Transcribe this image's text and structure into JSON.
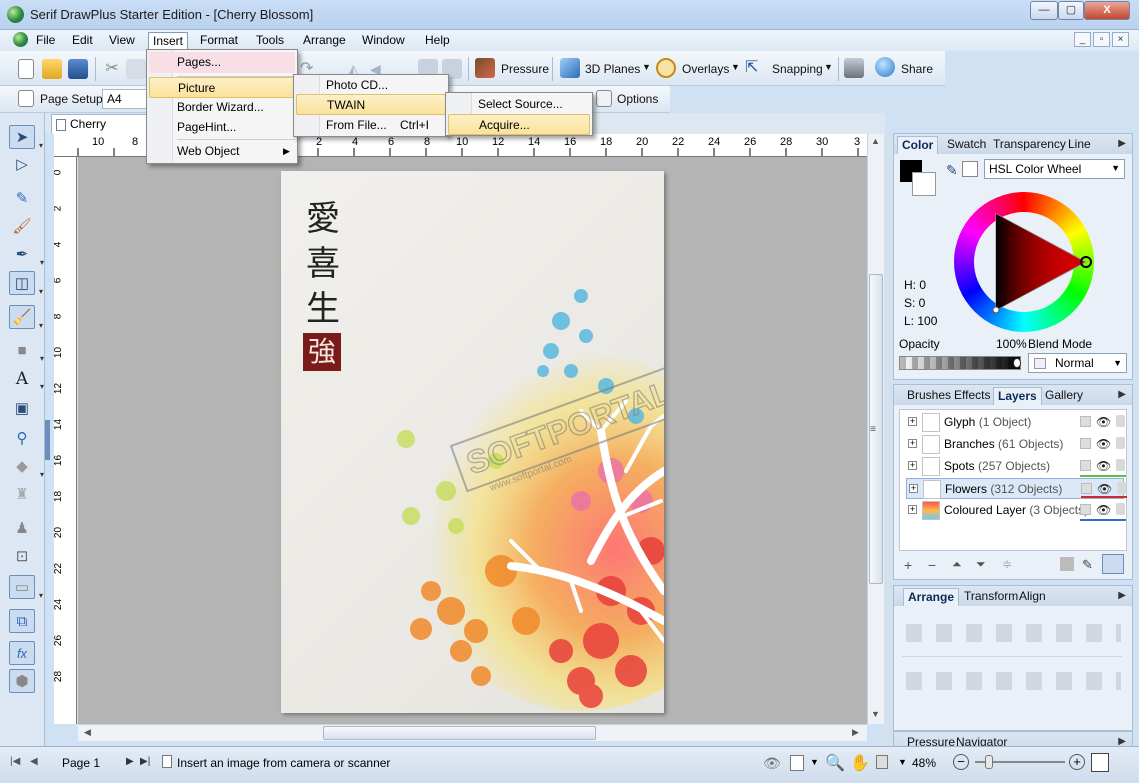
{
  "window": {
    "title": "Serif DrawPlus Starter Edition - [Cherry Blossom]",
    "min": "—",
    "max": "▢",
    "close": "X"
  },
  "menubar": {
    "items": [
      "File",
      "Edit",
      "View",
      "Insert",
      "Format",
      "Tools",
      "Arrange",
      "Window",
      "Help"
    ]
  },
  "toolbar1": {
    "pressure": "Pressure",
    "planes": "3D Planes",
    "overlays": "Overlays",
    "snapping": "Snapping",
    "share": "Share"
  },
  "toolbar2": {
    "page_setup": "Page Setup",
    "page_size": "A4",
    "options": "Options"
  },
  "document_tab": "Cherry Blossom",
  "ruler": {
    "unit": "cm",
    "h_ticks": [
      "10",
      "8",
      "2",
      "4",
      "6",
      "8",
      "10",
      "12",
      "14",
      "16",
      "18",
      "20",
      "22",
      "24",
      "26",
      "28",
      "30",
      "3"
    ],
    "v_ticks": [
      "0",
      "2",
      "4",
      "6",
      "8",
      "10",
      "12",
      "14",
      "16",
      "18",
      "20",
      "22",
      "24",
      "26",
      "28"
    ]
  },
  "artwork": {
    "kanji": [
      "愛",
      "喜",
      "生"
    ],
    "stamp": "強",
    "watermark": "SOFTPORTAL",
    "watermark_url": "www.softportal.com"
  },
  "insert_menu": {
    "items": [
      "Pages...",
      "Picture",
      "Border Wizard...",
      "PageHint...",
      "Web Object"
    ]
  },
  "picture_menu": {
    "items": [
      "Photo CD...",
      "TWAIN",
      "From File..."
    ],
    "from_file_shortcut": "Ctrl+I"
  },
  "twain_menu": {
    "items": [
      "Select Source...",
      "Acquire..."
    ]
  },
  "color_panel": {
    "tabs": [
      "Color",
      "Swatch",
      "Transparency",
      "Line"
    ],
    "mode": "HSL Color Wheel",
    "h": "H: 0",
    "s": "S: 0",
    "l": "L: 100",
    "opacity_label": "Opacity",
    "opacity_value": "100%",
    "blend_label": "Blend Mode",
    "blend_value": "Normal"
  },
  "layers_panel": {
    "tabs": [
      "Brushes",
      "Effects",
      "Layers",
      "Gallery"
    ],
    "layers": [
      {
        "name": "Glyph",
        "count": "(1 Object)",
        "color": "#d0d0d0"
      },
      {
        "name": "Branches",
        "count": "(61 Objects)",
        "color": "#d0d0d0"
      },
      {
        "name": "Spots",
        "count": "(257 Objects)",
        "color": "#5bbf4a"
      },
      {
        "name": "Flowers",
        "count": "(312 Objects)",
        "color": "#cc2b2b"
      },
      {
        "name": "Coloured Layer",
        "count": "(3 Objects)",
        "color": "#2f6fcc"
      }
    ]
  },
  "arrange_panel": {
    "tabs": [
      "Arrange",
      "Transform",
      "Align"
    ]
  },
  "bottom_panel": {
    "tabs": [
      "Pressure",
      "Navigator"
    ]
  },
  "status": {
    "page": "Page 1",
    "hint": "Insert an image from camera or scanner",
    "zoom": "48%"
  }
}
